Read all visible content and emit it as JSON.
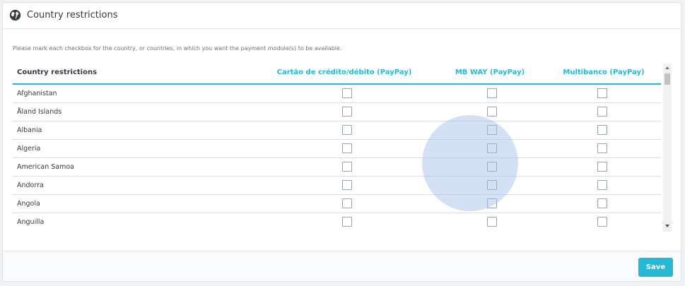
{
  "panel": {
    "title": "Country restrictions",
    "icon": "globe-icon",
    "help_text": "Please mark each checkbox for the country, or countries, in which you want the payment module(s) to be available."
  },
  "table": {
    "headers": {
      "country": "Country restrictions",
      "modules": [
        "Cartão de crédito/débito (PayPay)",
        "MB WAY (PayPay)",
        "Multibanco (PayPay)"
      ]
    },
    "rows": [
      {
        "country": "Afghanistan",
        "checked": [
          false,
          false,
          false
        ]
      },
      {
        "country": "Åland Islands",
        "checked": [
          false,
          false,
          false
        ]
      },
      {
        "country": "Albania",
        "checked": [
          false,
          false,
          false
        ]
      },
      {
        "country": "Algeria",
        "checked": [
          false,
          false,
          false
        ]
      },
      {
        "country": "American Samoa",
        "checked": [
          false,
          false,
          false
        ]
      },
      {
        "country": "Andorra",
        "checked": [
          false,
          false,
          false
        ]
      },
      {
        "country": "Angola",
        "checked": [
          false,
          false,
          false
        ]
      },
      {
        "country": "Anguilla",
        "checked": [
          false,
          false,
          false
        ]
      }
    ]
  },
  "footer": {
    "save_label": "Save"
  },
  "colors": {
    "accent": "#25b9d7",
    "text": "#363a41",
    "touch_overlay": "#a0bce6"
  }
}
